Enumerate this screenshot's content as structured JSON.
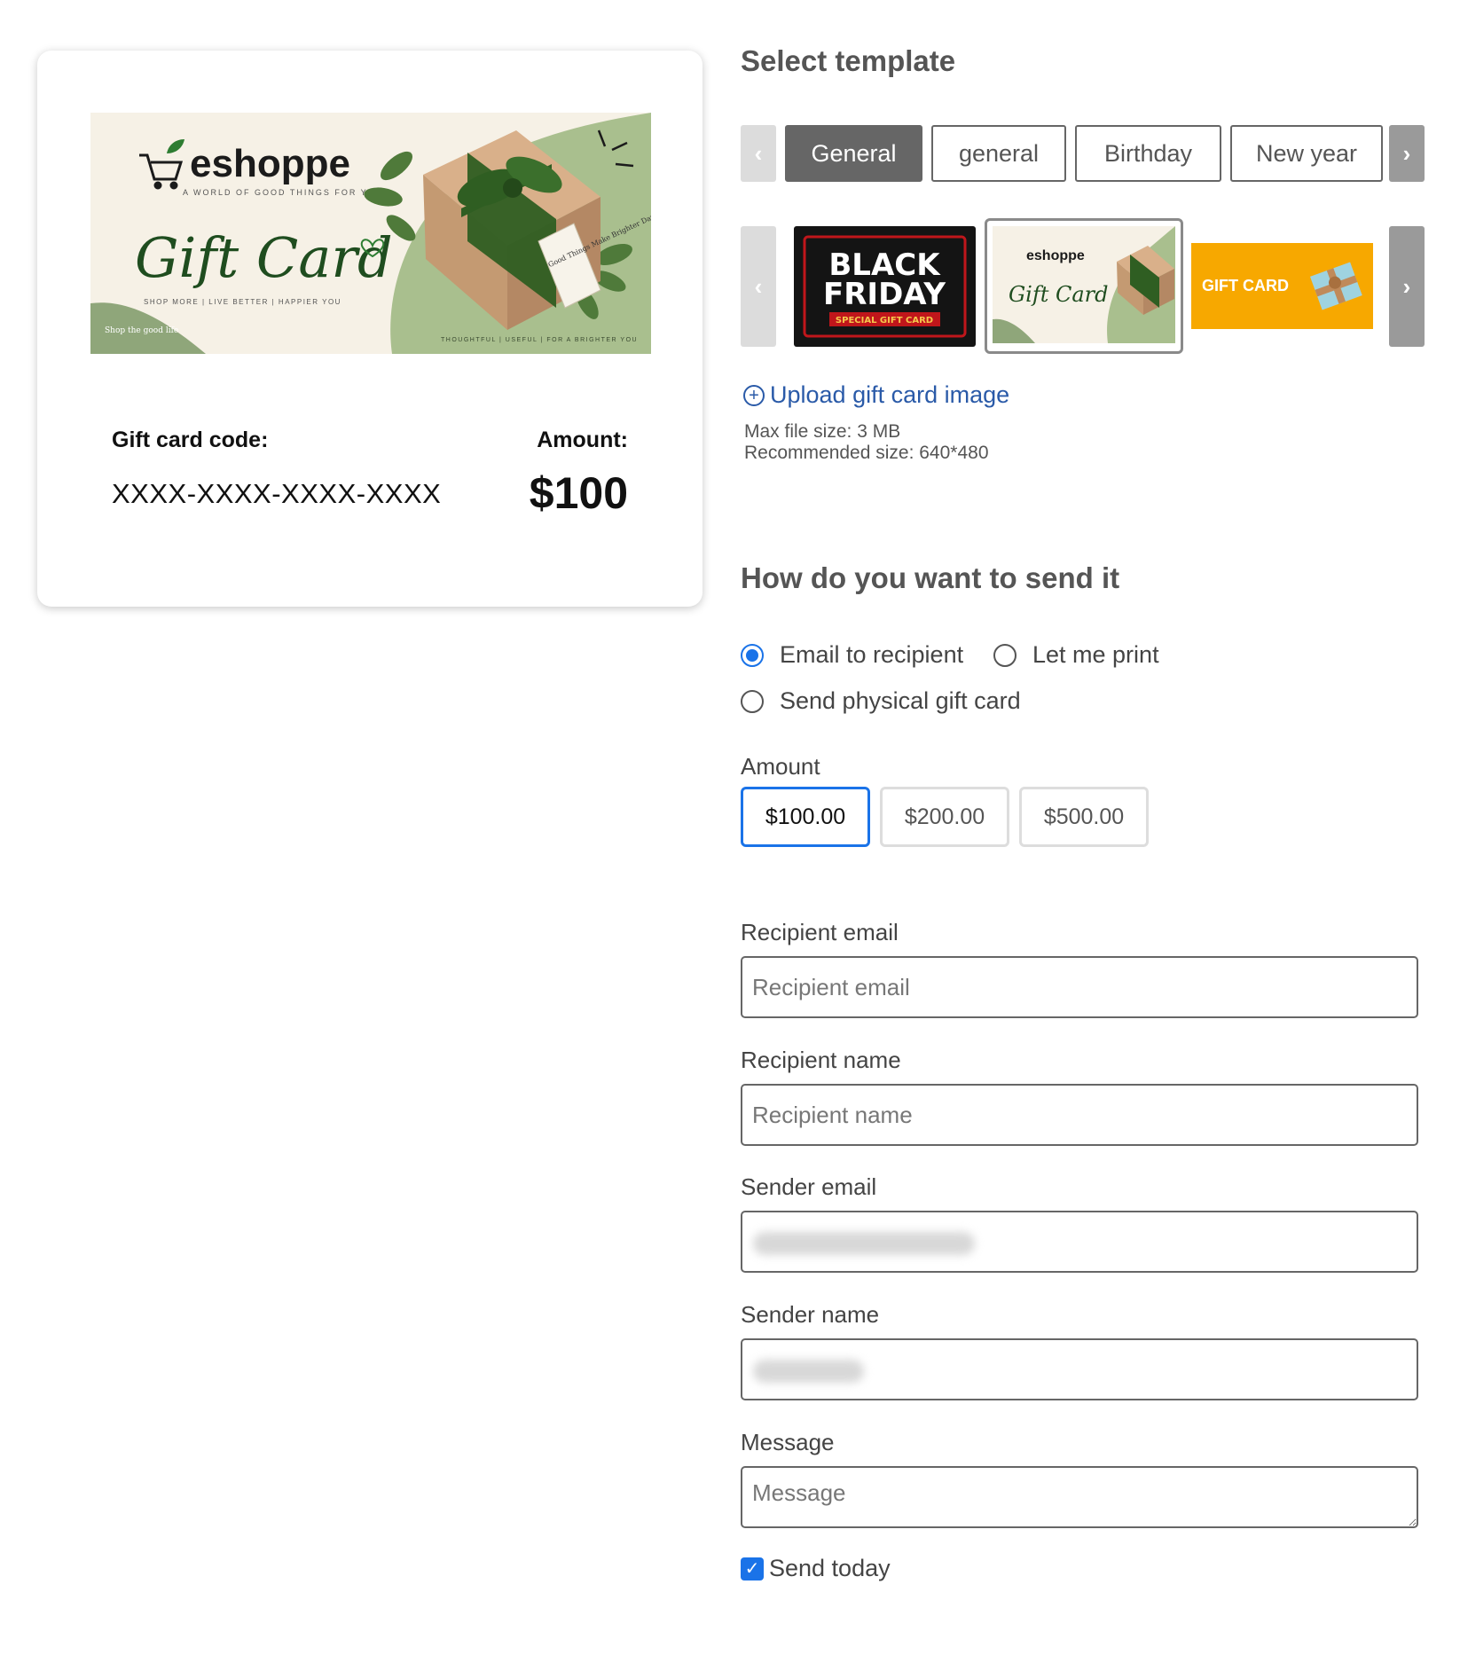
{
  "preview": {
    "brand": "eshoppe",
    "brand_tagline": "A WORLD OF GOOD THINGS FOR YOU",
    "card_script": "Gift Card",
    "card_slogans": "SHOP MORE  |  LIVE BETTER  |  HAPPIER YOU",
    "card_corner": "Shop the good life",
    "card_footer": "THOUGHTFUL  |  USEFUL  |  FOR A BRIGHTER YOU",
    "tag_text": "Good Things Make Brighter Days",
    "code_label": "Gift card code:",
    "code_value": "XXXX-XXXX-XXXX-XXXX",
    "amount_label": "Amount:",
    "amount_value": "$100"
  },
  "template": {
    "title": "Select template",
    "prev_label": "‹",
    "next_label": "›",
    "categories": [
      {
        "label": "General",
        "active": true
      },
      {
        "label": "general",
        "active": false
      },
      {
        "label": "Birthday",
        "active": false
      },
      {
        "label": "New year",
        "active": false
      }
    ],
    "thumbnails": [
      {
        "name": "Black Friday",
        "line1": "BLACK",
        "line2": "FRIDAY",
        "line3": "SPECIAL GIFT CARD"
      },
      {
        "name": "eshoppe Gift Card",
        "line1": "eshoppe",
        "line2": "Gift Card"
      },
      {
        "name": "Gift Card Orange",
        "line1": "GIFT CARD"
      }
    ],
    "upload_label": "Upload gift card image",
    "max_size": "Max file size: 3 MB",
    "recommended_size": "Recommended size: 640*480"
  },
  "send": {
    "title": "How do you want to send it",
    "options": [
      {
        "label": "Email to recipient",
        "checked": true
      },
      {
        "label": "Let me print",
        "checked": false
      },
      {
        "label": "Send physical gift card",
        "checked": false
      }
    ]
  },
  "amount": {
    "label": "Amount",
    "options": [
      {
        "label": "$100.00",
        "active": true
      },
      {
        "label": "$200.00",
        "active": false
      },
      {
        "label": "$500.00",
        "active": false
      }
    ]
  },
  "fields": {
    "recipient_email": {
      "label": "Recipient email",
      "placeholder": "Recipient email"
    },
    "recipient_name": {
      "label": "Recipient name",
      "placeholder": "Recipient name"
    },
    "sender_email": {
      "label": "Sender email"
    },
    "sender_name": {
      "label": "Sender name"
    },
    "message": {
      "label": "Message",
      "placeholder": "Message"
    }
  },
  "send_today": {
    "label": "Send today",
    "checked": true
  },
  "colors": {
    "accent": "#1a73e8",
    "link": "#2a5aa8",
    "brand_green": "#2e7d32",
    "gift_orange": "#f7a800"
  }
}
